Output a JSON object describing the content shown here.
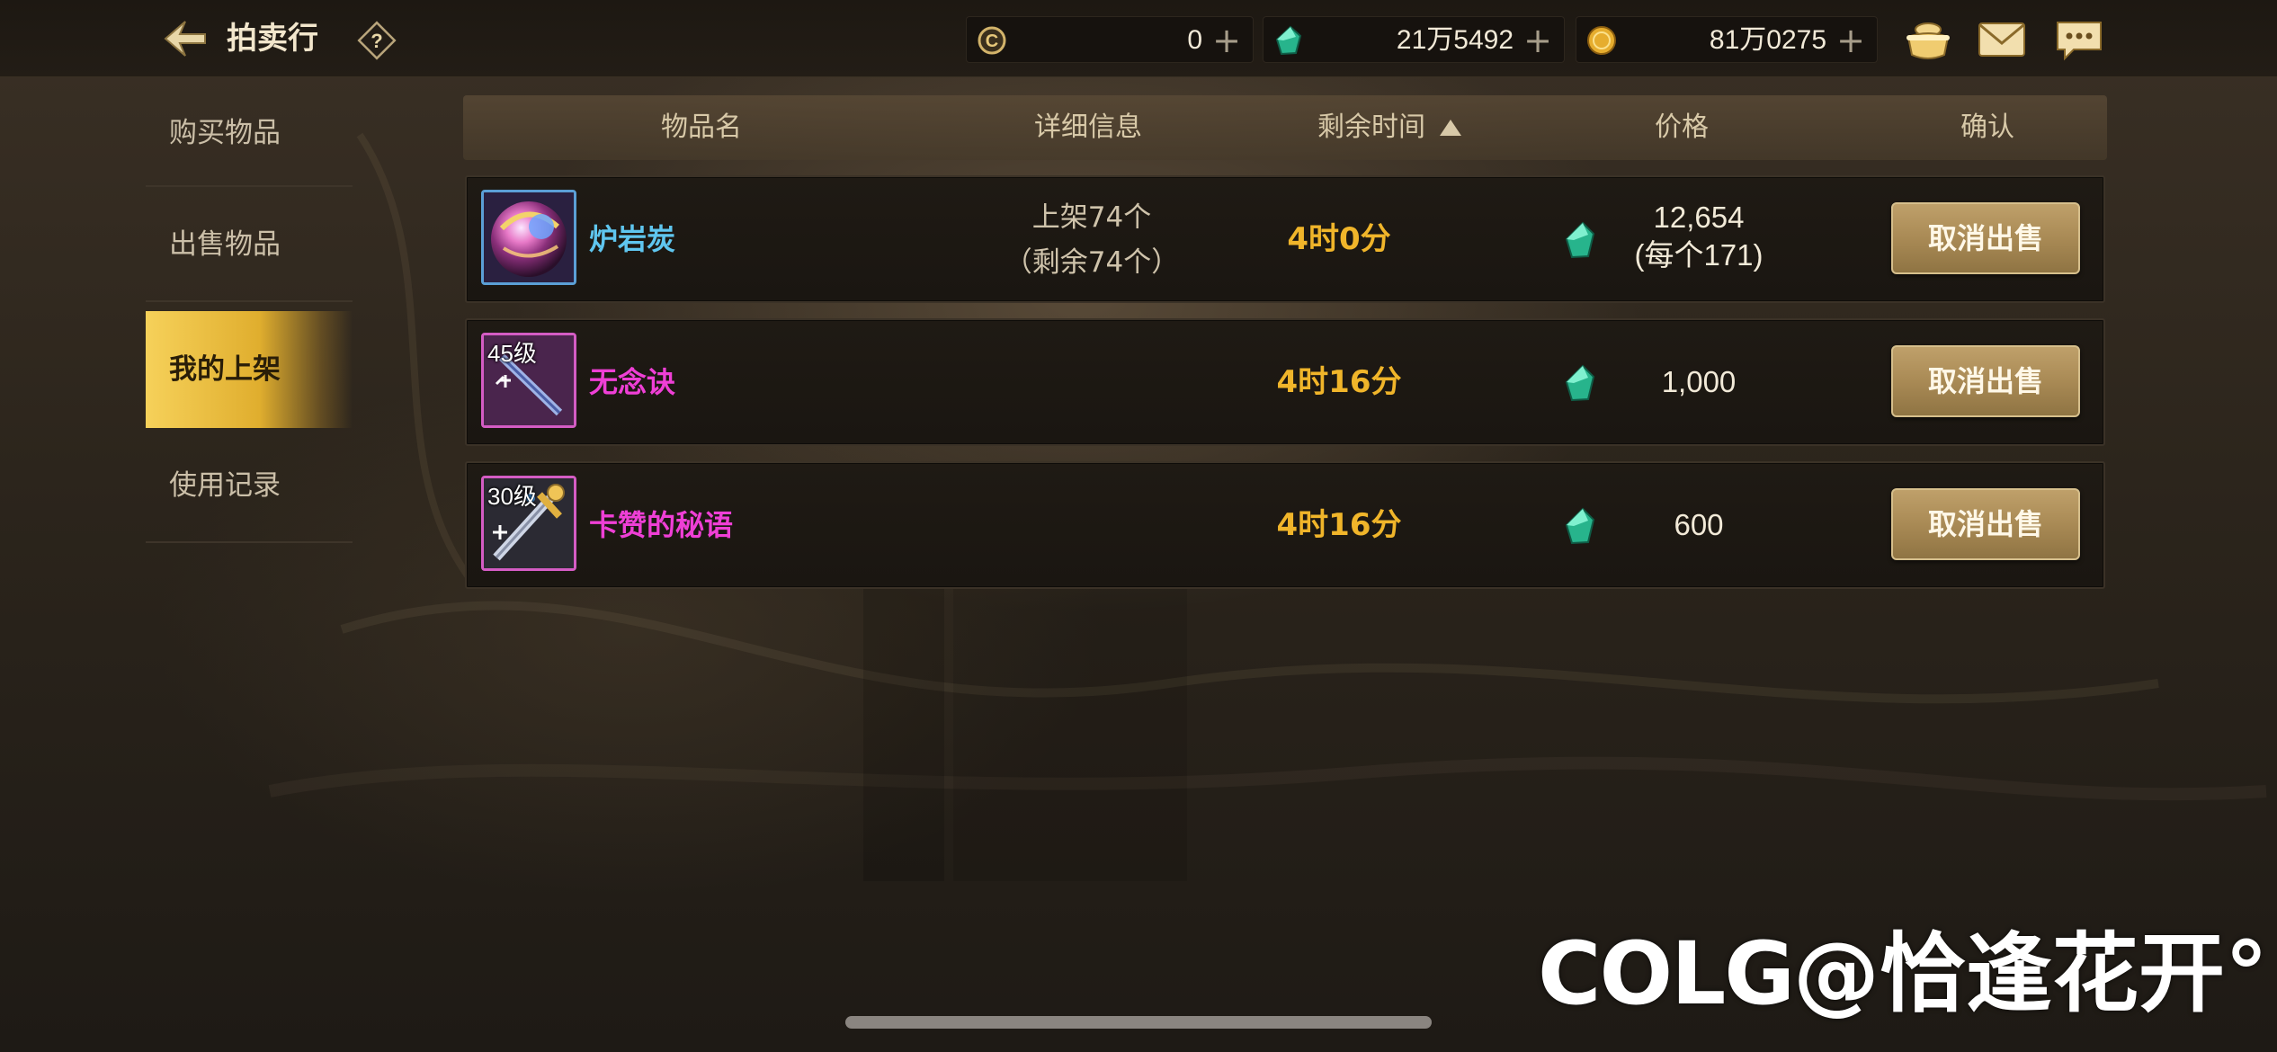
{
  "header": {
    "title": "拍卖行",
    "help_label": "?",
    "currencies": [
      {
        "icon": "c-coin-icon",
        "value": "0",
        "plus": "+"
      },
      {
        "icon": "green-gem-icon",
        "value": "21万5492",
        "plus": "+"
      },
      {
        "icon": "gold-coin-icon",
        "value": "81万0275",
        "plus": "+"
      }
    ],
    "right_icons": [
      "treasure-pot-icon",
      "mail-icon",
      "chat-icon"
    ]
  },
  "sidebar": {
    "items": [
      {
        "label": "购买物品",
        "active": false
      },
      {
        "label": "出售物品",
        "active": false
      },
      {
        "label": "我的上架",
        "active": true
      },
      {
        "label": "使用记录",
        "active": false
      }
    ]
  },
  "table": {
    "columns": {
      "name": "物品名",
      "detail": "详细信息",
      "time": "剩余时间",
      "price": "价格",
      "confirm": "确认"
    },
    "sort": "ascending",
    "rows": [
      {
        "name": "炉岩炭",
        "name_color": "#5fc6ef",
        "icon": "orb-icon",
        "level": "",
        "detail_line1": "上架74个",
        "detail_line2": "（剩余74个）",
        "time": "4时0分",
        "price": "12,654",
        "price_each": "(每个171)",
        "button": "取消出售"
      },
      {
        "name": "无念诀",
        "name_color": "#ef3fd6",
        "icon": "sword-scroll-icon",
        "level": "45级",
        "detail_line1": "",
        "detail_line2": "",
        "time": "4时16分",
        "price": "1,000",
        "price_each": "",
        "button": "取消出售"
      },
      {
        "name": "卡赞的秘语",
        "name_color": "#ef3fd6",
        "icon": "golden-sword-icon",
        "level": "30级",
        "detail_line1": "",
        "detail_line2": "",
        "time": "4时16分",
        "price": "600",
        "price_each": "",
        "button": "取消出售"
      }
    ]
  },
  "watermark": {
    "logo": "COLG",
    "text": "@恰逢花开°"
  },
  "colors": {
    "accent_gold": "#f0b52a",
    "nav_active": "#f6d15a",
    "button_bg": "#a98a55"
  }
}
